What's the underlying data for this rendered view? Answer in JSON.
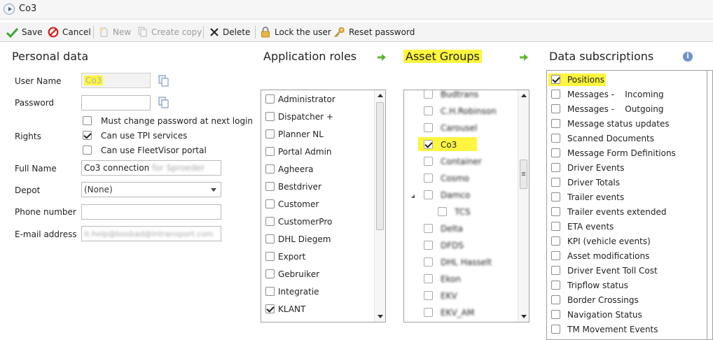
{
  "window": {
    "title": "Co3"
  },
  "toolbar": {
    "save": "Save",
    "cancel": "Cancel",
    "new": "New",
    "create_copy": "Create copy",
    "delete": "Delete",
    "lock_user": "Lock the user",
    "reset_password": "Reset password"
  },
  "sections": {
    "personal_data": "Personal data",
    "application_roles": "Application roles",
    "asset_groups": "Asset Groups",
    "data_subscriptions": "Data subscriptions"
  },
  "personal": {
    "username_label": "User Name",
    "username_value": "Co3",
    "password_label": "Password",
    "password_value": "",
    "must_change_label": "Must change password at next login",
    "must_change_checked": false,
    "rights_label": "Rights",
    "tpi_label": "Can use TPI services",
    "tpi_checked": true,
    "fleetvisor_label": "Can use FleetVisor portal",
    "fleetvisor_checked": false,
    "fullname_label": "Full Name",
    "fullname_value": "Co3 connection",
    "fullname_blurred": "for Sproeder",
    "depot_label": "Depot",
    "depot_value": "(None)",
    "phone_label": "Phone number",
    "phone_value": "",
    "email_label": "E-mail address",
    "email_blurred": "it.help@bosbad@intransport.com"
  },
  "roles": [
    {
      "label": "Administrator",
      "checked": false
    },
    {
      "label": "Dispatcher +",
      "checked": false
    },
    {
      "label": "Planner NL",
      "checked": false
    },
    {
      "label": "Portal Admin",
      "checked": false
    },
    {
      "label": "Agheera",
      "checked": false
    },
    {
      "label": "Bestdriver",
      "checked": false
    },
    {
      "label": "Customer",
      "checked": false
    },
    {
      "label": "CustomerPro",
      "checked": false
    },
    {
      "label": "DHL Diegem",
      "checked": false
    },
    {
      "label": "Export",
      "checked": false
    },
    {
      "label": "Gebruiker",
      "checked": false
    },
    {
      "label": "Integratie",
      "checked": false
    },
    {
      "label": "KLANT",
      "checked": true
    }
  ],
  "asset_groups": [
    {
      "label": "Budtrans",
      "checked": false,
      "blurred": true
    },
    {
      "label": "C.H.Robinson",
      "checked": false,
      "blurred": true
    },
    {
      "label": "Carousel",
      "checked": false,
      "blurred": true
    },
    {
      "label": "Co3",
      "checked": true,
      "blurred": false
    },
    {
      "label": "Container",
      "checked": false,
      "blurred": true
    },
    {
      "label": "Cosmo",
      "checked": false,
      "blurred": true
    },
    {
      "label": "Damco",
      "checked": false,
      "blurred": true
    },
    {
      "label": "TCS",
      "checked": false,
      "blurred": true
    },
    {
      "label": "Delta",
      "checked": false,
      "blurred": true
    },
    {
      "label": "DFDS",
      "checked": false,
      "blurred": true
    },
    {
      "label": "DHL Hasselt",
      "checked": false,
      "blurred": true
    },
    {
      "label": "Ekon",
      "checked": false,
      "blurred": true
    },
    {
      "label": "EKV",
      "checked": false,
      "blurred": true
    },
    {
      "label": "EKV_AM",
      "checked": false,
      "blurred": true
    }
  ],
  "subscriptions": [
    {
      "label": "Positions",
      "checked": true
    },
    {
      "label": "Messages -    Incoming",
      "checked": false
    },
    {
      "label": "Messages -    Outgoing",
      "checked": false
    },
    {
      "label": "Message status updates",
      "checked": false
    },
    {
      "label": "Scanned Documents",
      "checked": false
    },
    {
      "label": "Message Form Definitions",
      "checked": false
    },
    {
      "label": "Driver Events",
      "checked": false
    },
    {
      "label": "Driver Totals",
      "checked": false
    },
    {
      "label": "Trailer events",
      "checked": false
    },
    {
      "label": "Trailer events extended",
      "checked": false
    },
    {
      "label": "ETA events",
      "checked": false
    },
    {
      "label": "KPI (vehicle events)",
      "checked": false
    },
    {
      "label": "Asset modifications",
      "checked": false
    },
    {
      "label": "Driver Event Toll Cost",
      "checked": false
    },
    {
      "label": "Tripflow status",
      "checked": false
    },
    {
      "label": "Border Crossings",
      "checked": false
    },
    {
      "label": "Navigation Status",
      "checked": false
    },
    {
      "label": "TM Movement Events",
      "checked": false
    }
  ],
  "colors": {
    "highlight": "#fdf53f",
    "arrow_green": "#5cb531",
    "info_blue": "#6f93c6"
  }
}
